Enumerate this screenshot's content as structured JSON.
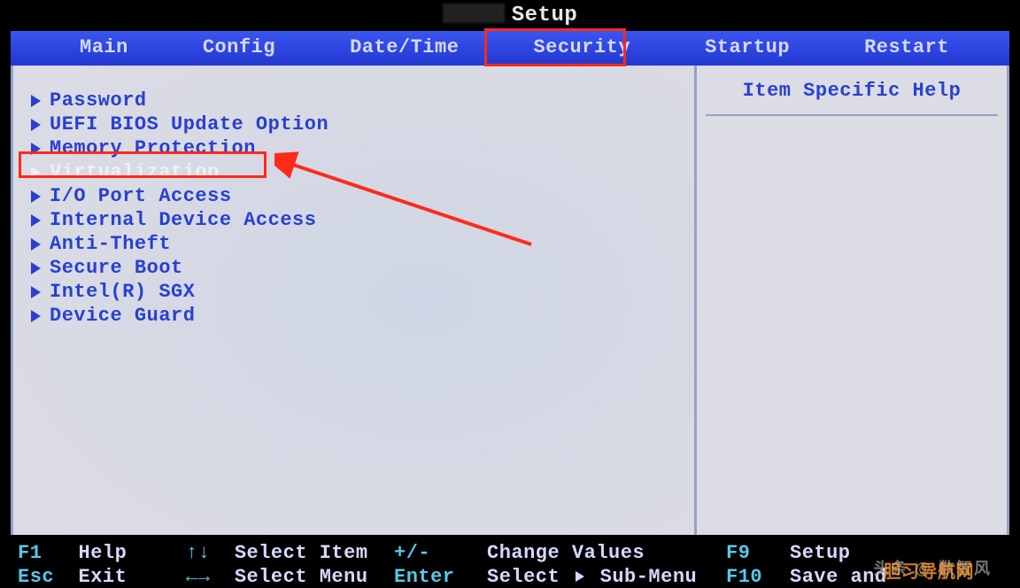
{
  "title": "Setup",
  "nav": {
    "items": [
      {
        "label": "Main"
      },
      {
        "label": "Config"
      },
      {
        "label": "Date/Time"
      },
      {
        "label": "Security"
      },
      {
        "label": "Startup"
      },
      {
        "label": "Restart"
      }
    ],
    "active_index": 3
  },
  "menu": {
    "items": [
      {
        "label": "Password"
      },
      {
        "label": "UEFI BIOS Update Option"
      },
      {
        "label": "Memory Protection"
      },
      {
        "label": "Virtualization"
      },
      {
        "label": "I/O Port Access"
      },
      {
        "label": "Internal Device Access"
      },
      {
        "label": "Anti-Theft"
      },
      {
        "label": "Secure Boot"
      },
      {
        "label": "Intel(R) SGX"
      },
      {
        "label": "Device Guard"
      }
    ],
    "selected_index": 3
  },
  "help_panel": {
    "title": "Item Specific Help"
  },
  "footer": {
    "row1": {
      "k1": "F1",
      "d1": "Help",
      "k2": "↑↓",
      "d2": "Select Item",
      "k3": "+/-",
      "d3": "Change Values",
      "k4": "F9",
      "d4": "Setup"
    },
    "row2": {
      "k1": "Esc",
      "d1": "Exit",
      "k2": "←→",
      "d2": "Select Menu",
      "k3": "Enter",
      "d3a": "Select",
      "d3b": "Sub-Menu",
      "k4": "F10",
      "d4": "Save and"
    }
  },
  "watermark1": "头条 @ 数智风",
  "watermark2": "胆习导航网"
}
